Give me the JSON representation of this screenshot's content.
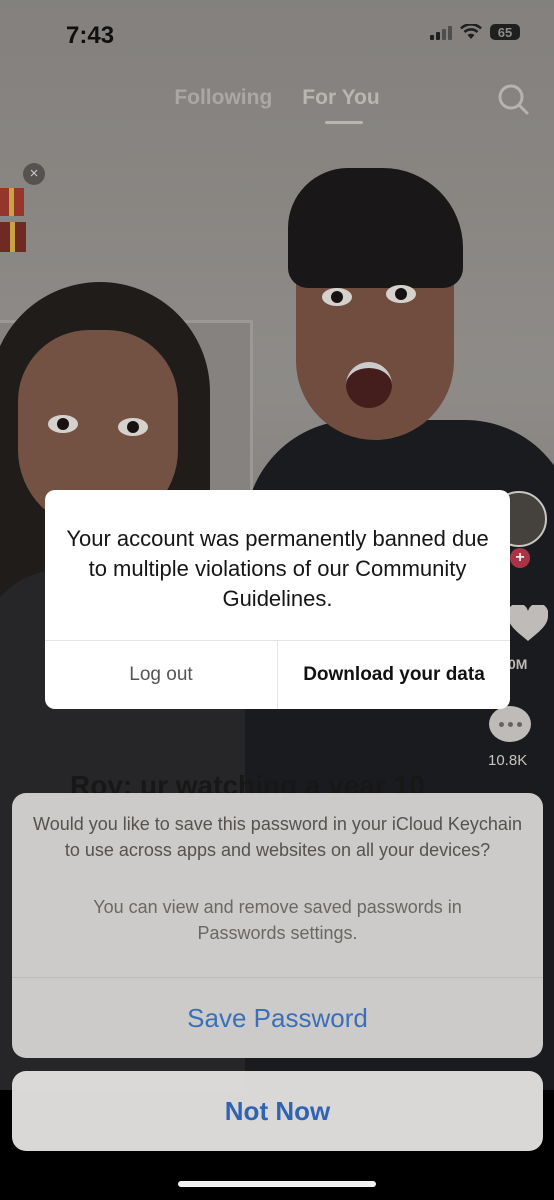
{
  "status_bar": {
    "time": "7:43",
    "battery": "65"
  },
  "nav": {
    "tabs": [
      {
        "label": "Following",
        "active": false
      },
      {
        "label": "For You",
        "active": true
      }
    ]
  },
  "video": {
    "caption": "Roy: ur watching a year 10",
    "like_count": "0M",
    "comment_count": "10.8K"
  },
  "alert": {
    "message": "Your account was permanently banned due to multiple violations of our Community Guidelines.",
    "logout_label": "Log out",
    "download_label": "Download your data"
  },
  "keychain_sheet": {
    "title": "Would you like to save this password in your iCloud Keychain to use across apps and websites on all your devices?",
    "subtitle": "You can view and remove saved passwords in Passwords settings.",
    "save_label": "Save Password",
    "not_now_label": "Not Now"
  },
  "colors": {
    "accent_blue": "#3b6fba",
    "follow_plus": "#b8394c"
  }
}
